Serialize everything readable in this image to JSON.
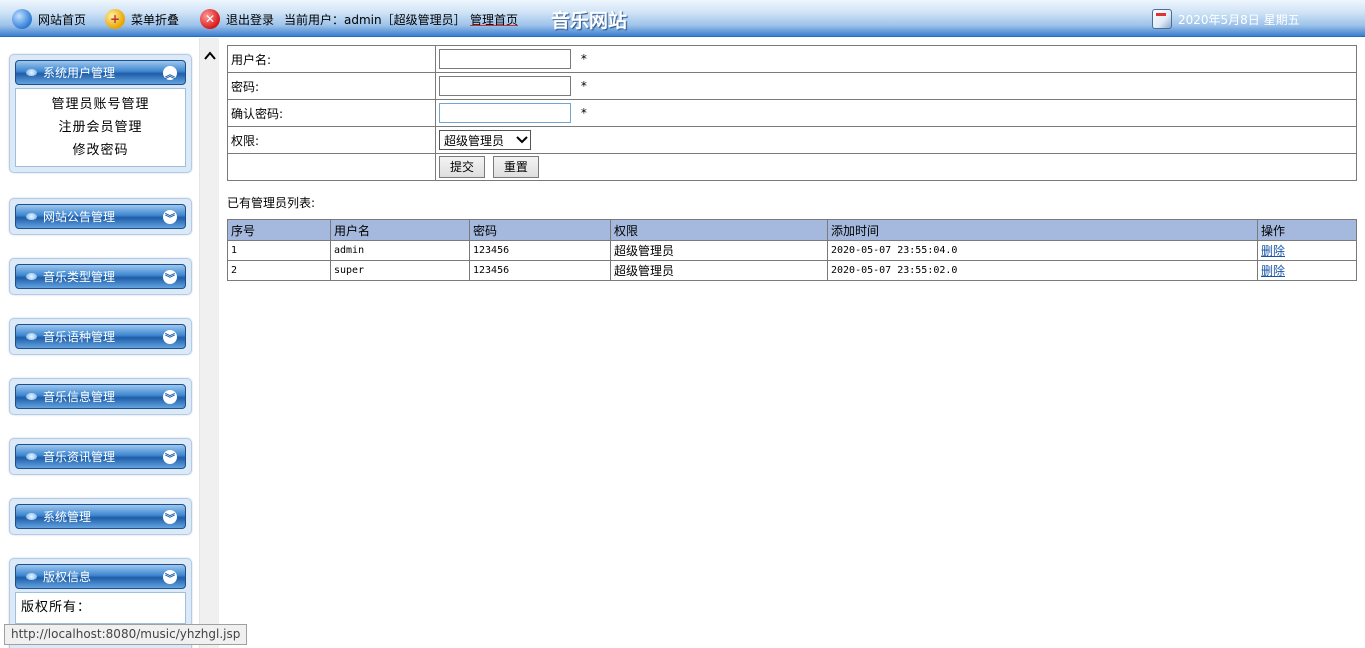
{
  "topbar": {
    "home_label": "网站首页",
    "menu_label": "菜单折叠",
    "logout_label": "退出登录",
    "current_user": "当前用户：admin［超级管理员］",
    "admin_home": "管理首页",
    "site_title": "音乐网站",
    "date": "2020年5月8日 星期五"
  },
  "sidebar": {
    "panels": [
      {
        "title": "系统用户管理",
        "links": [
          "管理员账号管理",
          "注册会员管理",
          "修改密码"
        ]
      },
      {
        "title": "网站公告管理"
      },
      {
        "title": "音乐类型管理"
      },
      {
        "title": "音乐语种管理"
      },
      {
        "title": "音乐信息管理"
      },
      {
        "title": "音乐资讯管理"
      },
      {
        "title": "系统管理"
      },
      {
        "title": "版权信息",
        "copyright": "版权所有："
      }
    ]
  },
  "form": {
    "username_label": "用户名:",
    "password_label": "密码:",
    "confirm_label": "确认密码:",
    "role_label": "权限:",
    "required_mark": "*",
    "role_selected": "超级管理员",
    "submit_label": "提交",
    "reset_label": "重置"
  },
  "list": {
    "title": "已有管理员列表:",
    "headers": [
      "序号",
      "用户名",
      "密码",
      "权限",
      "添加时间",
      "操作"
    ],
    "rows": [
      [
        "1",
        "admin",
        "123456",
        "超级管理员",
        "2020-05-07 23:55:04.0",
        "删除"
      ],
      [
        "2",
        "super",
        "123456",
        "超级管理员",
        "2020-05-07 23:55:02.0",
        "删除"
      ]
    ]
  },
  "status_url": "http://localhost:8080/music/yhzhgl.jsp"
}
